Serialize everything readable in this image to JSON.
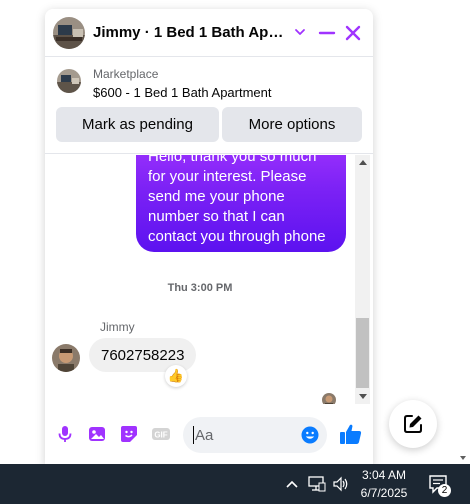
{
  "chat": {
    "header": {
      "title": "Jimmy · 1 Bed 1 Bath Apart...",
      "accent_color": "#a033ff"
    },
    "listing": {
      "source": "Marketplace",
      "title": "$600 - 1 Bed 1 Bath Apartment"
    },
    "actions": {
      "pending_label": "Mark as pending",
      "more_label": "More options"
    },
    "messages": {
      "outgoing_text": "Hello, thank you so much for your interest. Please send me your phone number so that I can contact you through phone",
      "timestamp": "Thu 3:00 PM",
      "sender_name": "Jimmy",
      "incoming_text": "7602758223",
      "reaction": "👍"
    },
    "composer": {
      "placeholder": "Aa",
      "icons": [
        "microphone-icon",
        "photo-icon",
        "sticker-icon",
        "gif-icon",
        "emoji-icon",
        "like-icon"
      ]
    }
  },
  "taskbar": {
    "time": "3:04 AM",
    "date": "6/7/2025",
    "notification_count": "2"
  }
}
